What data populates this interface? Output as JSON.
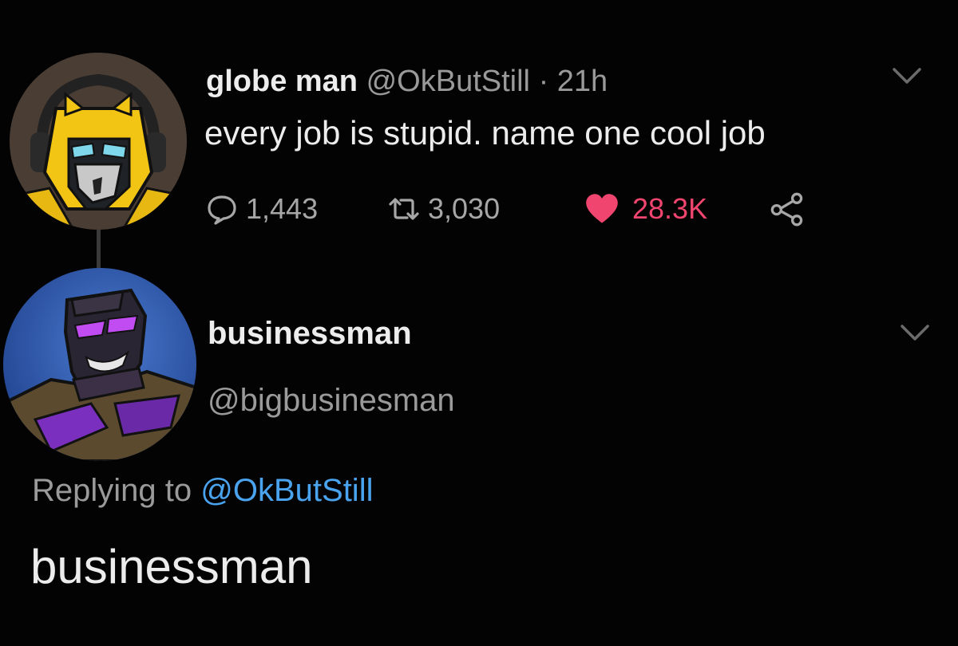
{
  "original_tweet": {
    "display_name": "globe man",
    "handle": "@OkButStill",
    "separator": "·",
    "time": "21h",
    "text": "every job is stupid. name one cool job",
    "avatar_icon": "yellow-robot-avatar-icon",
    "stats": {
      "replies": "1,443",
      "retweets": "3,030",
      "likes": "28.3K",
      "liked": true
    }
  },
  "reply_tweet": {
    "display_name": "businessman",
    "handle": "@bigbusinesman",
    "replying_label": "Replying to",
    "replying_handle": "@OkButStill",
    "text": "businessman",
    "avatar_icon": "purple-robot-avatar-icon"
  },
  "icons": {
    "reply": "speech-bubble-icon",
    "retweet": "retweet-arrows-icon",
    "like": "heart-icon",
    "share": "share-nodes-icon",
    "menu": "chevron-down-icon"
  },
  "colors": {
    "background": "#030303",
    "primary_text": "#ececec",
    "secondary_text": "#9a9a9a",
    "like_red": "#f0456e",
    "mention_blue": "#4aa3ee"
  }
}
